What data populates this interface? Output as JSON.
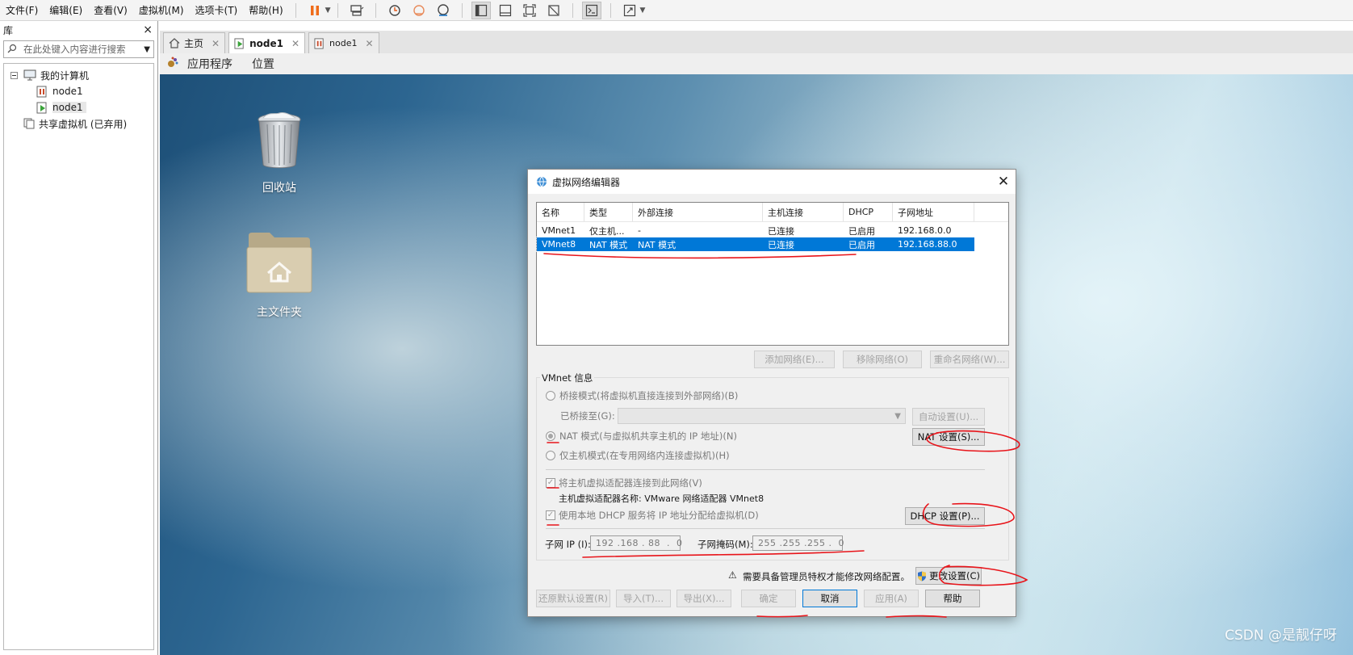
{
  "menubar": {
    "items": [
      "文件(F)",
      "编辑(E)",
      "查看(V)",
      "虚拟机(M)",
      "选项卡(T)",
      "帮助(H)"
    ]
  },
  "library": {
    "title": "库",
    "close": "×",
    "search_placeholder": "在此处键入内容进行搜索",
    "tree": {
      "root": "我的计算机",
      "vm1": "node1",
      "vm2": "node1",
      "shared": "共享虚拟机 (已弃用)"
    }
  },
  "tabs": [
    {
      "label": "主页"
    },
    {
      "label": "node1"
    },
    {
      "label": "node1"
    }
  ],
  "guest": {
    "menu_apps": "应用程序",
    "menu_places": "位置",
    "icons": {
      "trash": "回收站",
      "home": "主文件夹"
    },
    "watermark": "CSDN @是靓仔呀"
  },
  "dialog": {
    "title": "虚拟网络编辑器",
    "columns": [
      "名称",
      "类型",
      "外部连接",
      "主机连接",
      "DHCP",
      "子网地址"
    ],
    "rows": [
      [
        "VMnet1",
        "仅主机...",
        "-",
        "已连接",
        "已启用",
        "192.168.0.0"
      ],
      [
        "VMnet8",
        "NAT 模式",
        "NAT 模式",
        "已连接",
        "已启用",
        "192.168.88.0"
      ]
    ],
    "selected_row": 1,
    "btn_add": "添加网络(E)...",
    "btn_remove": "移除网络(O)",
    "btn_rename": "重命名网络(W)...",
    "group_title": "VMnet 信息",
    "radio_bridge": "桥接模式(将虚拟机直接连接到外部网络)(B)",
    "bridge_to": "已桥接至(G):",
    "btn_auto": "自动设置(U)...",
    "radio_nat": "NAT 模式(与虚拟机共享主机的 IP 地址)(N)",
    "btn_nat": "NAT 设置(S)...",
    "radio_host": "仅主机模式(在专用网络内连接虚拟机)(H)",
    "chk_connect": "将主机虚拟适配器连接到此网络(V)",
    "adapter_label": "主机虚拟适配器名称: VMware 网络适配器 VMnet8",
    "chk_dhcp": "使用本地 DHCP 服务将 IP 地址分配给虚拟机(D)",
    "btn_dhcp": "DHCP 设置(P)...",
    "subnet_ip_label": "子网 IP (I):",
    "subnet_ip": "192 .168 . 88  .  0",
    "subnet_mask_label": "子网掩码(M):",
    "subnet_mask": "255 .255 .255 .  0",
    "admin_warning": "需要具备管理员特权才能修改网络配置。",
    "warning_glyph": "⚠",
    "btn_change": "更改设置(C)",
    "btn_restore": "还原默认设置(R)",
    "btn_import": "导入(T)...",
    "btn_export": "导出(X)...",
    "btn_ok": "确定",
    "btn_cancel": "取消",
    "btn_apply": "应用(A)",
    "btn_help": "帮助"
  },
  "colors": {
    "selection": "#0078d7",
    "annotation": "#e8141a",
    "pause": "#ef6c1a"
  }
}
